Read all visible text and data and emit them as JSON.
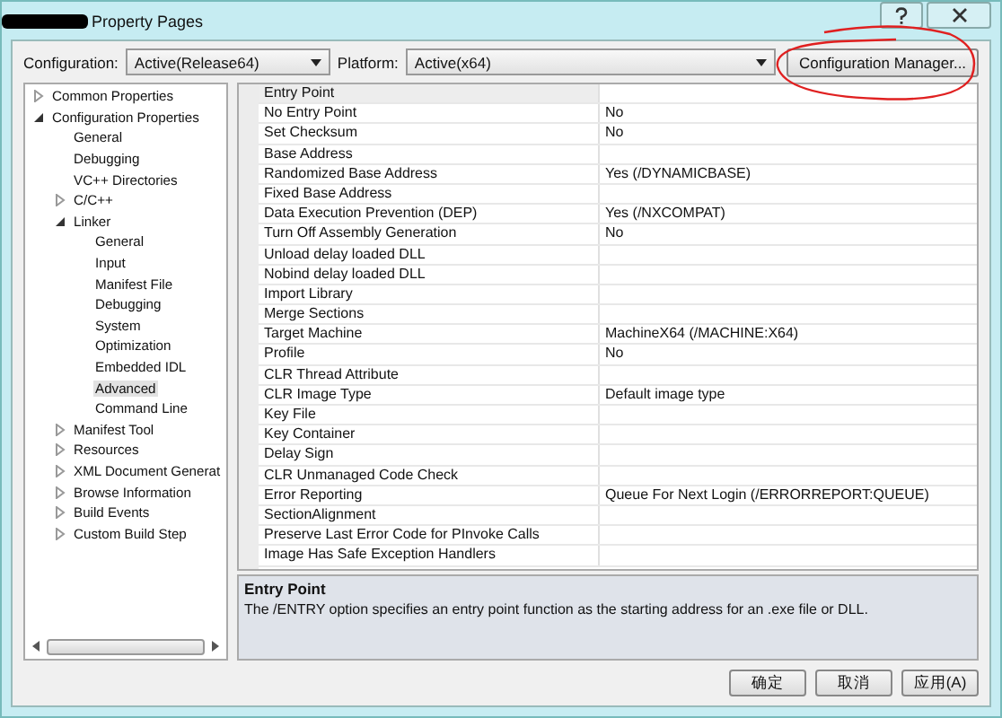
{
  "window": {
    "title": "Property Pages"
  },
  "configuration": {
    "label": "Configuration:",
    "value": "Active(Release64)"
  },
  "platform": {
    "label": "Platform:",
    "value": "Active(x64)"
  },
  "config_manager_button": "Configuration Manager...",
  "tree": [
    {
      "label": "Common Properties",
      "expanded": false,
      "selected": false
    },
    {
      "label": "Configuration Properties",
      "expanded": true,
      "selected": false,
      "children": [
        {
          "label": "General",
          "selected": false
        },
        {
          "label": "Debugging",
          "selected": false
        },
        {
          "label": "VC++ Directories",
          "selected": false
        },
        {
          "label": "C/C++",
          "expanded": false,
          "selected": false
        },
        {
          "label": "Linker",
          "expanded": true,
          "selected": false,
          "children": [
            {
              "label": "General",
              "selected": false
            },
            {
              "label": "Input",
              "selected": false
            },
            {
              "label": "Manifest File",
              "selected": false
            },
            {
              "label": "Debugging",
              "selected": false
            },
            {
              "label": "System",
              "selected": false
            },
            {
              "label": "Optimization",
              "selected": false
            },
            {
              "label": "Embedded IDL",
              "selected": false
            },
            {
              "label": "Advanced",
              "selected": true
            },
            {
              "label": "Command Line",
              "selected": false
            }
          ]
        },
        {
          "label": "Manifest Tool",
          "expanded": false,
          "selected": false
        },
        {
          "label": "Resources",
          "expanded": false,
          "selected": false
        },
        {
          "label": "XML Document Generat",
          "expanded": false,
          "selected": false
        },
        {
          "label": "Browse Information",
          "expanded": false,
          "selected": false
        },
        {
          "label": "Build Events",
          "expanded": false,
          "selected": false
        },
        {
          "label": "Custom Build Step",
          "expanded": false,
          "selected": false
        }
      ]
    }
  ],
  "properties": [
    {
      "name": "Entry Point",
      "selected": true
    },
    {
      "name": "No Entry Point",
      "value": "No",
      "selected": false
    },
    {
      "name": "Set Checksum",
      "value": "No",
      "selected": false
    },
    {
      "name": "Base Address",
      "selected": false
    },
    {
      "name": "Randomized Base Address",
      "value": "Yes (/DYNAMICBASE)",
      "selected": false
    },
    {
      "name": "Fixed Base Address",
      "selected": false
    },
    {
      "name": "Data Execution Prevention (DEP)",
      "value": "Yes (/NXCOMPAT)",
      "selected": false
    },
    {
      "name": "Turn Off Assembly Generation",
      "value": "No",
      "selected": false
    },
    {
      "name": "Unload delay loaded DLL",
      "selected": false
    },
    {
      "name": "Nobind delay loaded DLL",
      "selected": false
    },
    {
      "name": "Import Library",
      "selected": false
    },
    {
      "name": "Merge Sections",
      "selected": false
    },
    {
      "name": "Target Machine",
      "value": "MachineX64 (/MACHINE:X64)",
      "selected": false
    },
    {
      "name": "Profile",
      "value": "No",
      "selected": false
    },
    {
      "name": "CLR Thread Attribute",
      "selected": false
    },
    {
      "name": "CLR Image Type",
      "value": "Default image type",
      "selected": false
    },
    {
      "name": "Key File",
      "selected": false
    },
    {
      "name": "Key Container",
      "selected": false
    },
    {
      "name": "Delay Sign",
      "selected": false
    },
    {
      "name": "CLR Unmanaged Code Check",
      "selected": false
    },
    {
      "name": "Error Reporting",
      "value": "Queue For Next Login (/ERRORREPORT:QUEUE)",
      "selected": false
    },
    {
      "name": "SectionAlignment",
      "selected": false
    },
    {
      "name": "Preserve Last Error Code for PInvoke Calls",
      "selected": false
    },
    {
      "name": "Image Has Safe Exception Handlers",
      "selected": false
    }
  ],
  "description": {
    "title": "Entry Point",
    "text": "The /ENTRY option specifies an entry point function as the starting address for an .exe file or DLL."
  },
  "buttons": [
    "确定",
    "取消",
    "应用(A)"
  ]
}
